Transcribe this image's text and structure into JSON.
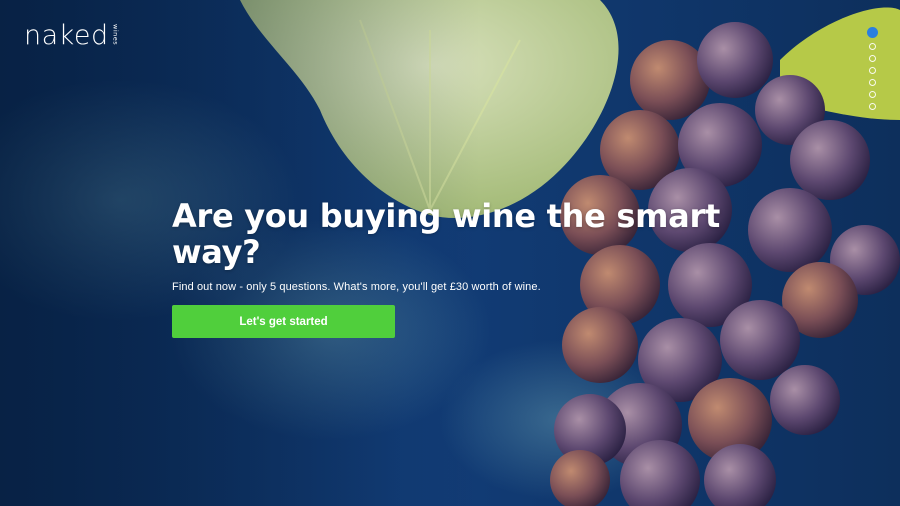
{
  "brand": {
    "name": "naked",
    "sub": "wines"
  },
  "hero": {
    "headline": "Are you buying wine the smart way?",
    "subtext": "Find out now - only 5 questions. What's more, you'll get £30 worth of wine.",
    "cta_label": "Let's get started"
  },
  "pagination": {
    "total": 7,
    "active": 1
  },
  "colors": {
    "cta": "#50cf3c",
    "active_dot": "#2a7fe0",
    "background": "#0b2a52"
  }
}
